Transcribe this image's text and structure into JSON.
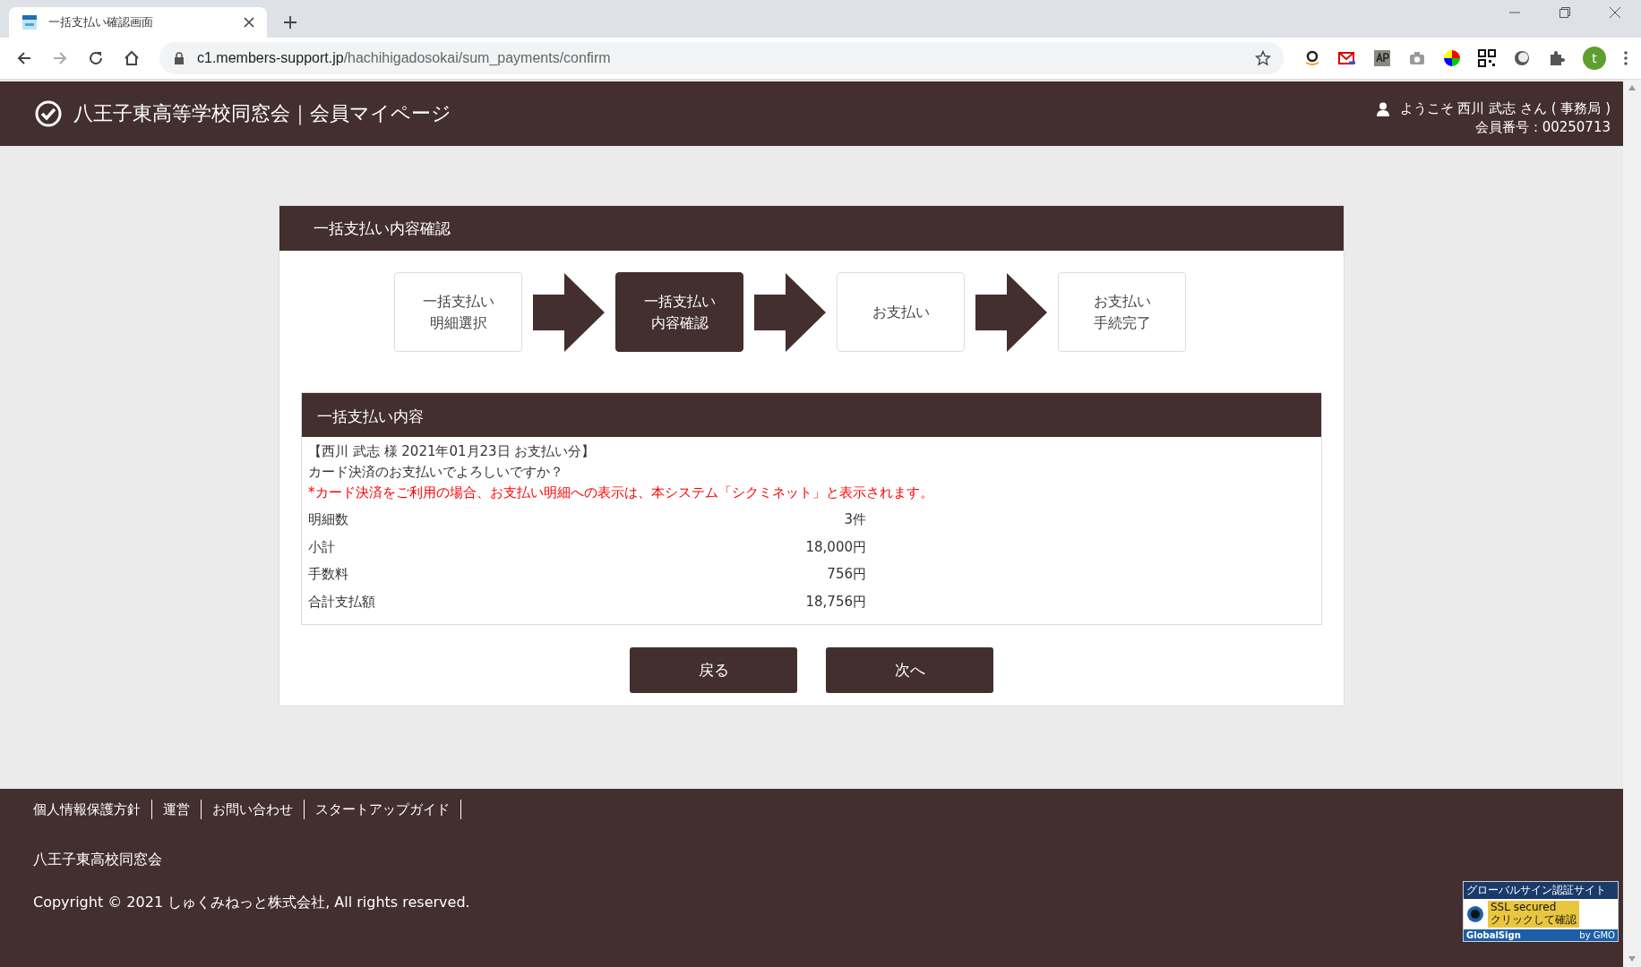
{
  "browser": {
    "tab": {
      "title": "一括支払い確認画面"
    },
    "url_host": "c1.members-support.jp",
    "url_path": "/hachihigadosokai/sum_payments/confirm",
    "profile_initial": "t"
  },
  "header": {
    "title": "八王子東高等学校同窓会｜会員マイページ",
    "welcome": "ようこそ 西川 武志 さん ( 事務局 )",
    "member_number": "会員番号：00250713"
  },
  "panel": {
    "title": "一括支払い内容確認",
    "steps": [
      {
        "lines": [
          "一括支払い",
          "明細選択"
        ],
        "selected": false
      },
      {
        "lines": [
          "一括支払い",
          "内容確認"
        ],
        "selected": true
      },
      {
        "lines": [
          "お支払い"
        ],
        "selected": false
      },
      {
        "lines": [
          "お支払い",
          "手続完了"
        ],
        "selected": false
      }
    ],
    "details": {
      "title": "一括支払い内容",
      "intro": "【西川 武志 様 2021年01月23日 お支払い分】",
      "question": "カード決済のお支払いでよろしいですか？",
      "notice": "*カード決済をご利用の場合、お支払い明細への表示は、本システム「シクミネット」と表示されます。",
      "rows": [
        {
          "label": "明細数",
          "value": "3件"
        },
        {
          "label": "小計",
          "value": "18,000円"
        },
        {
          "label": "手数料",
          "value": "756円"
        },
        {
          "label": "合計支払額",
          "value": "18,756円"
        }
      ]
    },
    "buttons": [
      "戻る",
      "次へ"
    ]
  },
  "footer": {
    "links": [
      "個人情報保護方針",
      "運営",
      "お問い合わせ",
      "スタートアップガイド"
    ],
    "organization": "八王子東高校同窓会",
    "copyright": "Copyright © 2021 しゅくみねっと株式会社, All rights reserved.",
    "ssl_badge": {
      "heading": "グローバルサイン認証サイト",
      "secured": "SSL secured",
      "click": "クリックして確認",
      "brand": "GlobalSign",
      "by": "by GMO"
    }
  }
}
